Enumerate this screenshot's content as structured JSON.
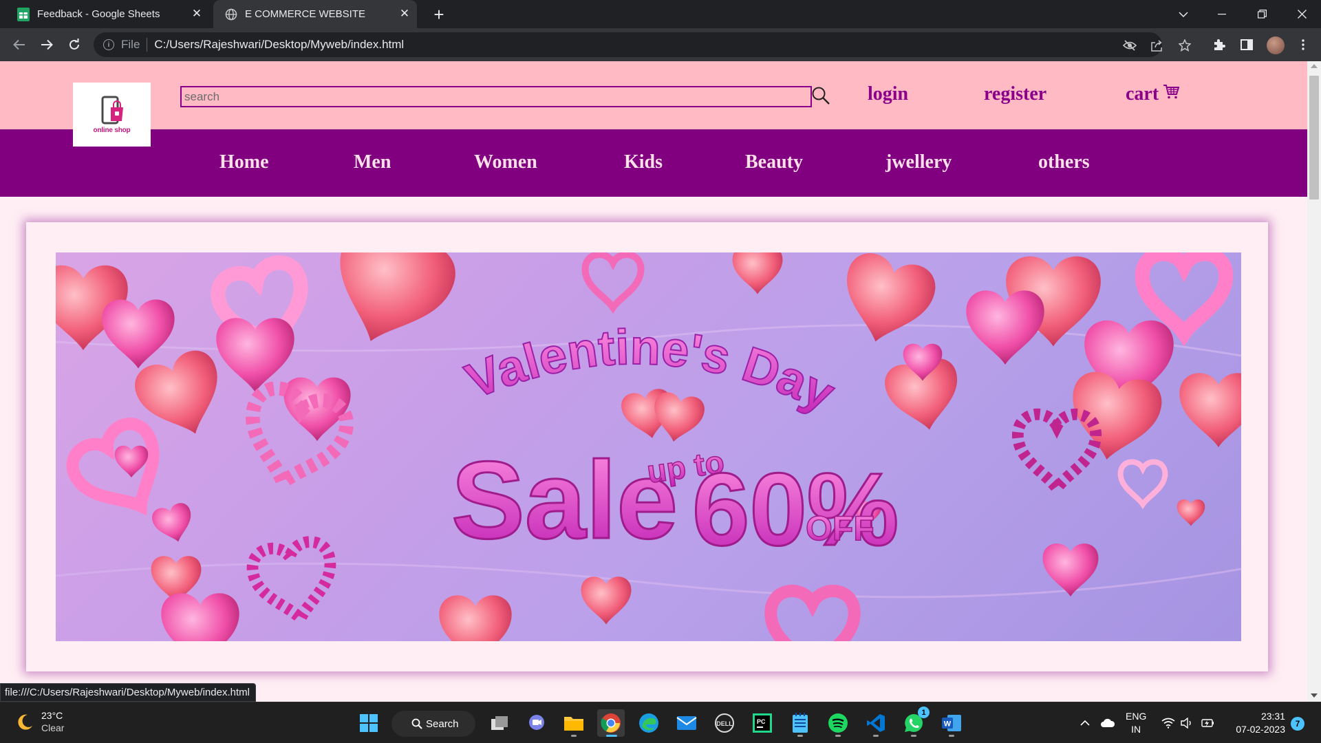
{
  "browser": {
    "tabs": [
      {
        "title": "Feedback - Google Sheets",
        "active": false
      },
      {
        "title": "E COMMERCE WEBSITE",
        "active": true
      }
    ],
    "address": {
      "scheme": "File",
      "url": "C:/Users/Rajeshwari/Desktop/Myweb/index.html"
    },
    "status_url": "file:///C:/Users/Rajeshwari/Desktop/Myweb/index.html"
  },
  "site": {
    "logo_text": "online shop",
    "search": {
      "placeholder": "search",
      "value": ""
    },
    "header_links": {
      "login": "login",
      "register": "register",
      "cart": "cart"
    },
    "nav": [
      "Home",
      "Men",
      "Women",
      "Kids",
      "Beauty",
      "jwellery",
      "others"
    ],
    "banner": {
      "title": "Valentine's Day",
      "sale": "Sale",
      "upto": "up to",
      "percent": "60%",
      "off": "OFF"
    },
    "colors": {
      "header_bg": "#ffbac4",
      "nav_bg": "#800080",
      "accent": "#8b008b",
      "page_bg": "#ffeef4"
    }
  },
  "taskbar": {
    "weather": {
      "temp": "23°C",
      "condition": "Clear"
    },
    "search_label": "Search",
    "language": {
      "line1": "ENG",
      "line2": "IN"
    },
    "clock": {
      "time": "23:31",
      "date": "07-02-2023"
    },
    "notification_count": "7",
    "whatsapp_badge": "1"
  }
}
